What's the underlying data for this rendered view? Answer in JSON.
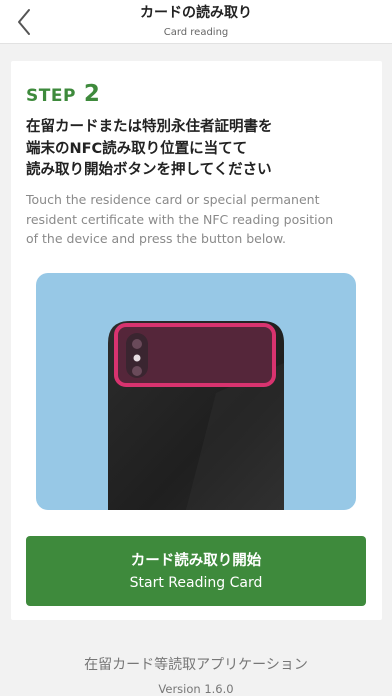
{
  "header": {
    "title": "カードの読み取り",
    "subtitle": "Card reading",
    "back_icon": "chevron-left-icon"
  },
  "step": {
    "word": "STEP",
    "number": "2"
  },
  "instruction": {
    "ja_lines": [
      "在留カードまたは特別永住者証明書を",
      "端末のNFC読み取り位置に当てて",
      "読み取り開始ボタンを押してください"
    ],
    "en_lines": [
      "Touch the residence card or special permanent",
      "resident certificate with the NFC reading position",
      "of the device and press the button below."
    ]
  },
  "button": {
    "label_ja": "カード読み取り開始",
    "label_en": "Start Reading Card"
  },
  "footer": {
    "app_name": "在留カード等読取アプリケーション",
    "version": "Version 1.6.0"
  },
  "colors": {
    "accent_green": "#3e8a3c",
    "illustration_bg": "#97c8e6",
    "phone_body": "#252525",
    "nfc_highlight": "#d8336f",
    "background": "#f2f2f2"
  }
}
